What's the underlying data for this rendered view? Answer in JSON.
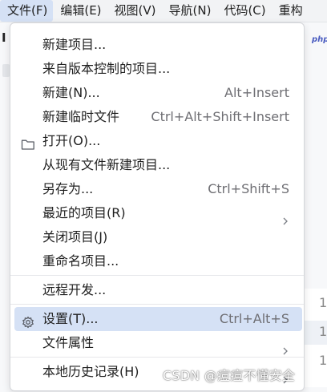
{
  "menubar": {
    "items": [
      {
        "label": "文件(F)",
        "active": true
      },
      {
        "label": "编辑(E)",
        "active": false
      },
      {
        "label": "视图(V)",
        "active": false
      },
      {
        "label": "导航(N)",
        "active": false
      },
      {
        "label": "代码(C)",
        "active": false
      },
      {
        "label": "重构",
        "active": false
      }
    ]
  },
  "background": {
    "left_glyph": "I",
    "right_label": "php",
    "line_numbers": [
      "1",
      "1",
      "1"
    ]
  },
  "file_menu": {
    "items": {
      "new_project": {
        "label": "新建项目..."
      },
      "from_vcs": {
        "label": "来自版本控制的项目..."
      },
      "new": {
        "label": "新建(N)...",
        "shortcut": "Alt+Insert"
      },
      "new_scratch": {
        "label": "新建临时文件",
        "shortcut": "Ctrl+Alt+Shift+Insert"
      },
      "open": {
        "label": "打开(O)...",
        "icon": "folder-icon"
      },
      "new_from_existing": {
        "label": "从现有文件新建项目..."
      },
      "save_as": {
        "label": "另存为...",
        "shortcut": "Ctrl+Shift+S"
      },
      "recent": {
        "label": "最近的项目(R)",
        "submenu": true
      },
      "close_project": {
        "label": "关闭项目(J)"
      },
      "rename_project": {
        "label": "重命名项目..."
      },
      "remote_dev": {
        "label": "远程开发..."
      },
      "settings": {
        "label": "设置(T)...",
        "shortcut": "Ctrl+Alt+S",
        "icon": "gear-icon",
        "selected": true
      },
      "file_properties": {
        "label": "文件属性",
        "submenu": true
      },
      "local_history": {
        "label": "本地历史记录(H)",
        "submenu": true
      }
    }
  },
  "watermark": "CSDN @痘痘不懂安全",
  "colors": {
    "menubar_bg": "#f2f3f5",
    "active_highlight": "#d5e1f5",
    "menu_bg": "#ffffff",
    "shortcut_text": "#6e6e73"
  }
}
